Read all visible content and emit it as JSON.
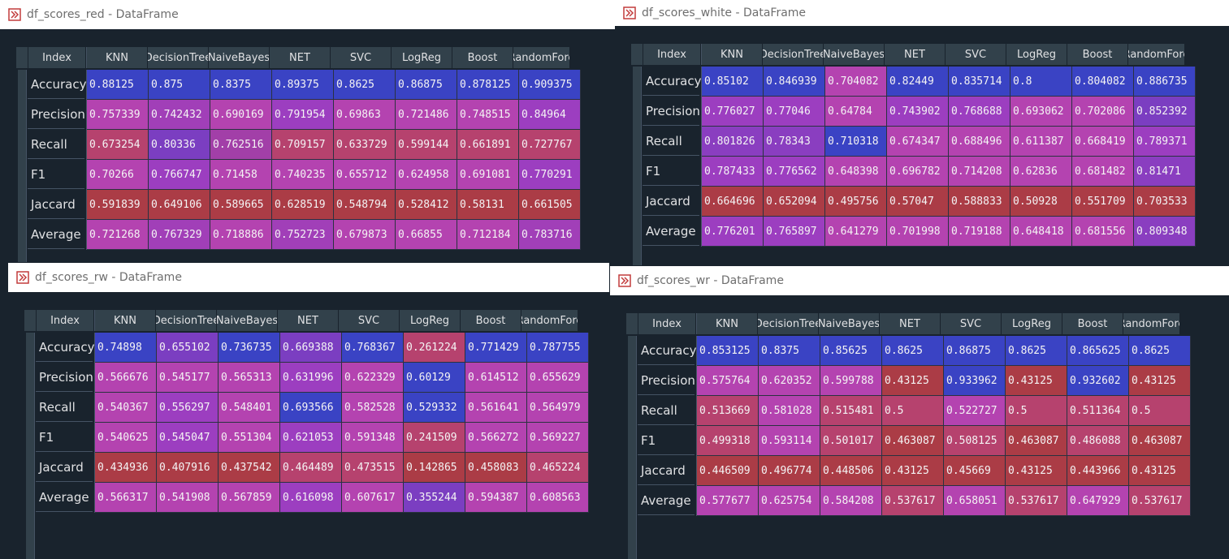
{
  "windows": [
    {
      "title": "df_scores_red - DataFrame",
      "index_label": "Index",
      "columns": [
        "KNN",
        "DecisionTree",
        "NaiveBayes",
        "NET",
        "SVC",
        "LogReg",
        "Boost",
        "RandomFore"
      ],
      "rows": [
        {
          "label": "Accuracy",
          "values": [
            "0.88125",
            "0.875",
            "0.8375",
            "0.89375",
            "0.8625",
            "0.86875",
            "0.878125",
            "0.909375"
          ]
        },
        {
          "label": "Precision",
          "values": [
            "0.757339",
            "0.742432",
            "0.690169",
            "0.791954",
            "0.69863",
            "0.721486",
            "0.748515",
            "0.84964"
          ]
        },
        {
          "label": "Recall",
          "values": [
            "0.673254",
            "0.80336",
            "0.762516",
            "0.709157",
            "0.633729",
            "0.599144",
            "0.661891",
            "0.727767"
          ]
        },
        {
          "label": "F1",
          "values": [
            "0.70266",
            "0.766747",
            "0.71458",
            "0.740235",
            "0.655712",
            "0.624958",
            "0.691081",
            "0.770291"
          ]
        },
        {
          "label": "Jaccard",
          "values": [
            "0.591839",
            "0.649106",
            "0.589665",
            "0.628519",
            "0.548794",
            "0.528412",
            "0.58131",
            "0.661505"
          ]
        },
        {
          "label": "Average",
          "values": [
            "0.721268",
            "0.767329",
            "0.718886",
            "0.752723",
            "0.679873",
            "0.66855",
            "0.712184",
            "0.783716"
          ]
        }
      ],
      "colors": [
        [
          "#3a43c4",
          "#3a43c4",
          "#3a43c4",
          "#3a43c4",
          "#3a43c4",
          "#3a43c4",
          "#3a43c4",
          "#3a43c4"
        ],
        [
          "#b443b0",
          "#a13fb8",
          "#b443b0",
          "#9c3ec0",
          "#b443b0",
          "#b443b0",
          "#b443b0",
          "#9c3ec0"
        ],
        [
          "#b6426e",
          "#7b3ec1",
          "#a23fa8",
          "#b6426e",
          "#b6426e",
          "#b6426e",
          "#b6426e",
          "#b6426e"
        ],
        [
          "#b443b0",
          "#9c3ec0",
          "#b443b0",
          "#b443b0",
          "#b443b0",
          "#b443b0",
          "#b443b0",
          "#9c3ec0"
        ],
        [
          "#ab3c46",
          "#ab3c46",
          "#ab3c46",
          "#ab3c46",
          "#ab3c46",
          "#ab3c46",
          "#ab3c46",
          "#ab3c46"
        ],
        [
          "#b443b0",
          "#a13fb8",
          "#b443b0",
          "#a13fb8",
          "#b443b0",
          "#b443b0",
          "#b443b0",
          "#a13fb8"
        ]
      ]
    },
    {
      "title": "df_scores_white - DataFrame",
      "index_label": "Index",
      "columns": [
        "KNN",
        "DecisionTree",
        "NaiveBayes",
        "NET",
        "SVC",
        "LogReg",
        "Boost",
        "RandomFore"
      ],
      "rows": [
        {
          "label": "Accuracy",
          "values": [
            "0.85102",
            "0.846939",
            "0.704082",
            "0.82449",
            "0.835714",
            "0.8",
            "0.804082",
            "0.886735"
          ]
        },
        {
          "label": "Precision",
          "values": [
            "0.776027",
            "0.77046",
            "0.64784",
            "0.743902",
            "0.768688",
            "0.693062",
            "0.702086",
            "0.852392"
          ]
        },
        {
          "label": "Recall",
          "values": [
            "0.801826",
            "0.78343",
            "0.710318",
            "0.674347",
            "0.688496",
            "0.611387",
            "0.668419",
            "0.789371"
          ]
        },
        {
          "label": "F1",
          "values": [
            "0.787433",
            "0.776562",
            "0.648398",
            "0.696782",
            "0.714208",
            "0.62836",
            "0.681482",
            "0.81471"
          ]
        },
        {
          "label": "Jaccard",
          "values": [
            "0.664696",
            "0.652094",
            "0.495756",
            "0.57047",
            "0.588833",
            "0.50928",
            "0.551709",
            "0.703533"
          ]
        },
        {
          "label": "Average",
          "values": [
            "0.776201",
            "0.765897",
            "0.641279",
            "0.701998",
            "0.719188",
            "0.648418",
            "0.681556",
            "0.809348"
          ]
        }
      ],
      "colors": [
        [
          "#3a43c4",
          "#3a43c4",
          "#b443b0",
          "#3a43c4",
          "#3a43c4",
          "#3a43c4",
          "#3a43c4",
          "#3a43c4"
        ],
        [
          "#9c3ec0",
          "#9c3ec0",
          "#b443b0",
          "#9c3ec0",
          "#9c3ec0",
          "#b443b0",
          "#b443b0",
          "#7b3ec1"
        ],
        [
          "#8a3ec0",
          "#8a3ec0",
          "#3a43c4",
          "#b443b0",
          "#b443b0",
          "#b443b0",
          "#b443b0",
          "#9c3ec0"
        ],
        [
          "#9c3ec0",
          "#9c3ec0",
          "#b443b0",
          "#b443b0",
          "#b443b0",
          "#b443b0",
          "#b443b0",
          "#8a3ec0"
        ],
        [
          "#ab3c46",
          "#ab3c46",
          "#ab3c46",
          "#ab3c46",
          "#ab3c46",
          "#ab3c46",
          "#ab3c46",
          "#ab3c46"
        ],
        [
          "#9c3ec0",
          "#9c3ec0",
          "#b443b0",
          "#b443b0",
          "#b443b0",
          "#b443b0",
          "#b443b0",
          "#8a3ec0"
        ]
      ]
    },
    {
      "title": "df_scores_rw - DataFrame",
      "index_label": "Index",
      "columns": [
        "KNN",
        "DecisionTree",
        "NaiveBayes",
        "NET",
        "SVC",
        "LogReg",
        "Boost",
        "RandomFore"
      ],
      "rows": [
        {
          "label": "Accuracy",
          "values": [
            "0.74898",
            "0.655102",
            "0.736735",
            "0.669388",
            "0.768367",
            "0.261224",
            "0.771429",
            "0.787755"
          ]
        },
        {
          "label": "Precision",
          "values": [
            "0.566676",
            "0.545177",
            "0.565313",
            "0.631996",
            "0.622329",
            "0.60129",
            "0.614512",
            "0.655629"
          ]
        },
        {
          "label": "Recall",
          "values": [
            "0.540367",
            "0.556297",
            "0.548401",
            "0.693566",
            "0.582528",
            "0.529332",
            "0.561641",
            "0.564979"
          ]
        },
        {
          "label": "F1",
          "values": [
            "0.540625",
            "0.545047",
            "0.551304",
            "0.621053",
            "0.591348",
            "0.241509",
            "0.566272",
            "0.569227"
          ]
        },
        {
          "label": "Jaccard",
          "values": [
            "0.434936",
            "0.407916",
            "0.437542",
            "0.464489",
            "0.473515",
            "0.142865",
            "0.458083",
            "0.465224"
          ]
        },
        {
          "label": "Average",
          "values": [
            "0.566317",
            "0.541908",
            "0.567859",
            "0.616098",
            "0.607617",
            "0.355244",
            "0.594387",
            "0.608563"
          ]
        }
      ],
      "colors": [
        [
          "#3a43c4",
          "#7b3ec1",
          "#3a43c4",
          "#7b3ec1",
          "#3a43c4",
          "#b6426e",
          "#3a43c4",
          "#3a43c4"
        ],
        [
          "#b443b0",
          "#b443b0",
          "#b443b0",
          "#9c3ec0",
          "#b443b0",
          "#3a43c4",
          "#b443b0",
          "#b443b0"
        ],
        [
          "#b443b0",
          "#9c3ec0",
          "#b443b0",
          "#3a43c4",
          "#b443b0",
          "#3a43c4",
          "#b443b0",
          "#b443b0"
        ],
        [
          "#b443b0",
          "#9c3ec0",
          "#b443b0",
          "#9c3ec0",
          "#b443b0",
          "#b6426e",
          "#b443b0",
          "#b443b0"
        ],
        [
          "#ab3c46",
          "#ab3c46",
          "#ab3c46",
          "#b6426e",
          "#b6426e",
          "#ab3c46",
          "#ab3c46",
          "#b6426e"
        ],
        [
          "#b443b0",
          "#b443b0",
          "#b443b0",
          "#9c3ec0",
          "#b443b0",
          "#7b3ec1",
          "#b443b0",
          "#b443b0"
        ]
      ]
    },
    {
      "title": "df_scores_wr - DataFrame",
      "index_label": "Index",
      "columns": [
        "KNN",
        "DecisionTree",
        "NaiveBayes",
        "NET",
        "SVC",
        "LogReg",
        "Boost",
        "RandomFore"
      ],
      "rows": [
        {
          "label": "Accuracy",
          "values": [
            "0.853125",
            "0.8375",
            "0.85625",
            "0.8625",
            "0.86875",
            "0.8625",
            "0.865625",
            "0.8625"
          ]
        },
        {
          "label": "Precision",
          "values": [
            "0.575764",
            "0.620352",
            "0.599788",
            "0.43125",
            "0.933962",
            "0.43125",
            "0.932602",
            "0.43125"
          ]
        },
        {
          "label": "Recall",
          "values": [
            "0.513669",
            "0.581028",
            "0.515481",
            "0.5",
            "0.522727",
            "0.5",
            "0.511364",
            "0.5"
          ]
        },
        {
          "label": "F1",
          "values": [
            "0.499318",
            "0.593114",
            "0.501017",
            "0.463087",
            "0.508125",
            "0.463087",
            "0.486088",
            "0.463087"
          ]
        },
        {
          "label": "Jaccard",
          "values": [
            "0.446509",
            "0.496774",
            "0.448506",
            "0.43125",
            "0.45669",
            "0.43125",
            "0.443966",
            "0.43125"
          ]
        },
        {
          "label": "Average",
          "values": [
            "0.577677",
            "0.625754",
            "0.584208",
            "0.537617",
            "0.658051",
            "0.537617",
            "0.647929",
            "0.537617"
          ]
        }
      ],
      "colors": [
        [
          "#3a43c4",
          "#3a43c4",
          "#3a43c4",
          "#3a43c4",
          "#3a43c4",
          "#3a43c4",
          "#3a43c4",
          "#3a43c4"
        ],
        [
          "#b443b0",
          "#b443b0",
          "#b443b0",
          "#ab3c46",
          "#3a43c4",
          "#ab3c46",
          "#3a43c4",
          "#ab3c46"
        ],
        [
          "#b6426e",
          "#b443b0",
          "#b6426e",
          "#b6426e",
          "#b443b0",
          "#b6426e",
          "#b6426e",
          "#b6426e"
        ],
        [
          "#b6426e",
          "#b443b0",
          "#b6426e",
          "#ab3c46",
          "#b6426e",
          "#ab3c46",
          "#b6426e",
          "#ab3c46"
        ],
        [
          "#ab3c46",
          "#ab3c46",
          "#ab3c46",
          "#ab3c46",
          "#ab3c46",
          "#ab3c46",
          "#ab3c46",
          "#ab3c46"
        ],
        [
          "#b443b0",
          "#b443b0",
          "#b443b0",
          "#b6426e",
          "#b443b0",
          "#b6426e",
          "#b443b0",
          "#b6426e"
        ]
      ]
    }
  ]
}
